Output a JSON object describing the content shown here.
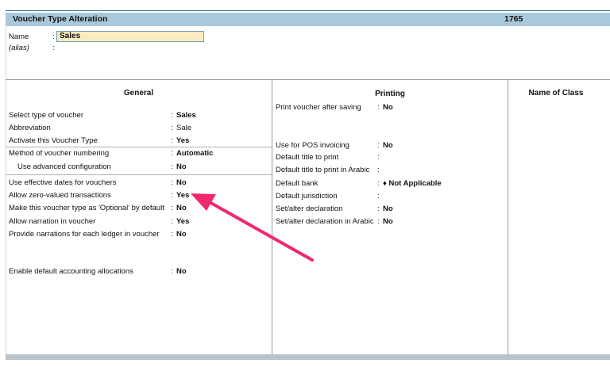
{
  "window": {
    "title": "Voucher Type Alteration",
    "company_code": "1765"
  },
  "name_section": {
    "name_label": "Name",
    "name_sep": ":",
    "name_value": "Sales",
    "alias_label": "(alias)",
    "alias_sep": ":"
  },
  "columns": {
    "general": "General",
    "printing": "Printing",
    "name_of_class": "Name of Class"
  },
  "general_fields": [
    {
      "label": "Select type of voucher",
      "sep": ":",
      "value": "Sales",
      "bold": true
    },
    {
      "label": "Abbreviation",
      "sep": ":",
      "value": "Sale",
      "bold": false
    },
    {
      "label": "Activate this Voucher Type",
      "sep": ":",
      "value": "Yes",
      "bold": true
    },
    {
      "label": "Method of voucher numbering",
      "sep": ":",
      "value": "Automatic",
      "bold": true
    },
    {
      "label": "Use advanced configuration",
      "sep": ":",
      "value": "No",
      "bold": true
    },
    {
      "label": "Use effective dates for vouchers",
      "sep": ":",
      "value": "No",
      "bold": true
    },
    {
      "label": "Allow zero-valued transactions",
      "sep": ":",
      "value": "Yes",
      "bold": true
    },
    {
      "label": "Make this voucher type as 'Optional' by default",
      "sep": ":",
      "value": "No",
      "bold": true
    },
    {
      "label": "Allow narration in voucher",
      "sep": ":",
      "value": "Yes",
      "bold": true
    },
    {
      "label": "Provide narrations for each ledger in voucher",
      "sep": ":",
      "value": "No",
      "bold": true
    },
    {
      "label": "Enable default accounting allocations",
      "sep": ":",
      "value": "No",
      "bold": true
    }
  ],
  "printing_fields": [
    {
      "label": "Print voucher after saving",
      "sep": ":",
      "value": "No"
    },
    {
      "label": "Use for POS invoicing",
      "sep": ":",
      "value": "No"
    },
    {
      "label": "Default title to print",
      "sep": ":",
      "value": ""
    },
    {
      "label": "Default title to print in Arabic",
      "sep": ":",
      "value": ""
    },
    {
      "label": "Default bank",
      "sep": ":",
      "value": "♦ Not Applicable"
    },
    {
      "label": "Default jurisdiction",
      "sep": ":",
      "value": ""
    },
    {
      "label": "Set/alter declaration",
      "sep": ":",
      "value": "No"
    },
    {
      "label": "Set/alter declaration in Arabic",
      "sep": ":",
      "value": "No"
    }
  ],
  "annotation": {
    "color": "#f0286e"
  }
}
